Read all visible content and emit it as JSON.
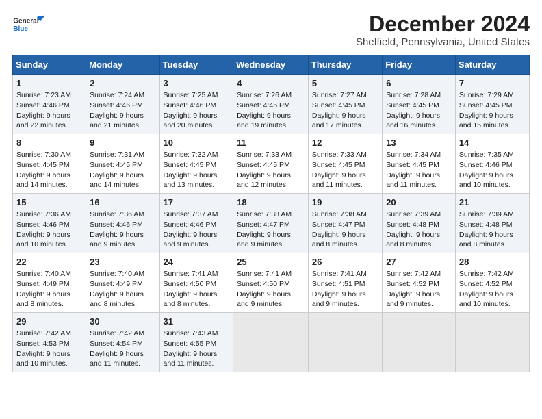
{
  "header": {
    "logo_line1": "General",
    "logo_line2": "Blue",
    "title": "December 2024",
    "subtitle": "Sheffield, Pennsylvania, United States"
  },
  "calendar": {
    "days_of_week": [
      "Sunday",
      "Monday",
      "Tuesday",
      "Wednesday",
      "Thursday",
      "Friday",
      "Saturday"
    ],
    "weeks": [
      [
        {
          "day": "",
          "empty": true
        },
        {
          "day": "",
          "empty": true
        },
        {
          "day": "",
          "empty": true
        },
        {
          "day": "",
          "empty": true
        },
        {
          "day": "",
          "empty": true
        },
        {
          "day": "",
          "empty": true
        },
        {
          "day": "",
          "empty": true
        }
      ],
      [
        {
          "day": "1",
          "sunrise": "7:23 AM",
          "sunset": "4:46 PM",
          "daylight": "9 hours and 22 minutes."
        },
        {
          "day": "2",
          "sunrise": "7:24 AM",
          "sunset": "4:46 PM",
          "daylight": "9 hours and 21 minutes."
        },
        {
          "day": "3",
          "sunrise": "7:25 AM",
          "sunset": "4:46 PM",
          "daylight": "9 hours and 20 minutes."
        },
        {
          "day": "4",
          "sunrise": "7:26 AM",
          "sunset": "4:45 PM",
          "daylight": "9 hours and 19 minutes."
        },
        {
          "day": "5",
          "sunrise": "7:27 AM",
          "sunset": "4:45 PM",
          "daylight": "9 hours and 17 minutes."
        },
        {
          "day": "6",
          "sunrise": "7:28 AM",
          "sunset": "4:45 PM",
          "daylight": "9 hours and 16 minutes."
        },
        {
          "day": "7",
          "sunrise": "7:29 AM",
          "sunset": "4:45 PM",
          "daylight": "9 hours and 15 minutes."
        }
      ],
      [
        {
          "day": "8",
          "sunrise": "7:30 AM",
          "sunset": "4:45 PM",
          "daylight": "9 hours and 14 minutes."
        },
        {
          "day": "9",
          "sunrise": "7:31 AM",
          "sunset": "4:45 PM",
          "daylight": "9 hours and 14 minutes."
        },
        {
          "day": "10",
          "sunrise": "7:32 AM",
          "sunset": "4:45 PM",
          "daylight": "9 hours and 13 minutes."
        },
        {
          "day": "11",
          "sunrise": "7:33 AM",
          "sunset": "4:45 PM",
          "daylight": "9 hours and 12 minutes."
        },
        {
          "day": "12",
          "sunrise": "7:33 AM",
          "sunset": "4:45 PM",
          "daylight": "9 hours and 11 minutes."
        },
        {
          "day": "13",
          "sunrise": "7:34 AM",
          "sunset": "4:45 PM",
          "daylight": "9 hours and 11 minutes."
        },
        {
          "day": "14",
          "sunrise": "7:35 AM",
          "sunset": "4:46 PM",
          "daylight": "9 hours and 10 minutes."
        }
      ],
      [
        {
          "day": "15",
          "sunrise": "7:36 AM",
          "sunset": "4:46 PM",
          "daylight": "9 hours and 10 minutes."
        },
        {
          "day": "16",
          "sunrise": "7:36 AM",
          "sunset": "4:46 PM",
          "daylight": "9 hours and 9 minutes."
        },
        {
          "day": "17",
          "sunrise": "7:37 AM",
          "sunset": "4:46 PM",
          "daylight": "9 hours and 9 minutes."
        },
        {
          "day": "18",
          "sunrise": "7:38 AM",
          "sunset": "4:47 PM",
          "daylight": "9 hours and 9 minutes."
        },
        {
          "day": "19",
          "sunrise": "7:38 AM",
          "sunset": "4:47 PM",
          "daylight": "9 hours and 8 minutes."
        },
        {
          "day": "20",
          "sunrise": "7:39 AM",
          "sunset": "4:48 PM",
          "daylight": "9 hours and 8 minutes."
        },
        {
          "day": "21",
          "sunrise": "7:39 AM",
          "sunset": "4:48 PM",
          "daylight": "9 hours and 8 minutes."
        }
      ],
      [
        {
          "day": "22",
          "sunrise": "7:40 AM",
          "sunset": "4:49 PM",
          "daylight": "9 hours and 8 minutes."
        },
        {
          "day": "23",
          "sunrise": "7:40 AM",
          "sunset": "4:49 PM",
          "daylight": "9 hours and 8 minutes."
        },
        {
          "day": "24",
          "sunrise": "7:41 AM",
          "sunset": "4:50 PM",
          "daylight": "9 hours and 8 minutes."
        },
        {
          "day": "25",
          "sunrise": "7:41 AM",
          "sunset": "4:50 PM",
          "daylight": "9 hours and 9 minutes."
        },
        {
          "day": "26",
          "sunrise": "7:41 AM",
          "sunset": "4:51 PM",
          "daylight": "9 hours and 9 minutes."
        },
        {
          "day": "27",
          "sunrise": "7:42 AM",
          "sunset": "4:52 PM",
          "daylight": "9 hours and 9 minutes."
        },
        {
          "day": "28",
          "sunrise": "7:42 AM",
          "sunset": "4:52 PM",
          "daylight": "9 hours and 10 minutes."
        }
      ],
      [
        {
          "day": "29",
          "sunrise": "7:42 AM",
          "sunset": "4:53 PM",
          "daylight": "9 hours and 10 minutes."
        },
        {
          "day": "30",
          "sunrise": "7:42 AM",
          "sunset": "4:54 PM",
          "daylight": "9 hours and 11 minutes."
        },
        {
          "day": "31",
          "sunrise": "7:43 AM",
          "sunset": "4:55 PM",
          "daylight": "9 hours and 11 minutes."
        },
        {
          "day": "",
          "empty": true
        },
        {
          "day": "",
          "empty": true
        },
        {
          "day": "",
          "empty": true
        },
        {
          "day": "",
          "empty": true
        }
      ]
    ]
  }
}
